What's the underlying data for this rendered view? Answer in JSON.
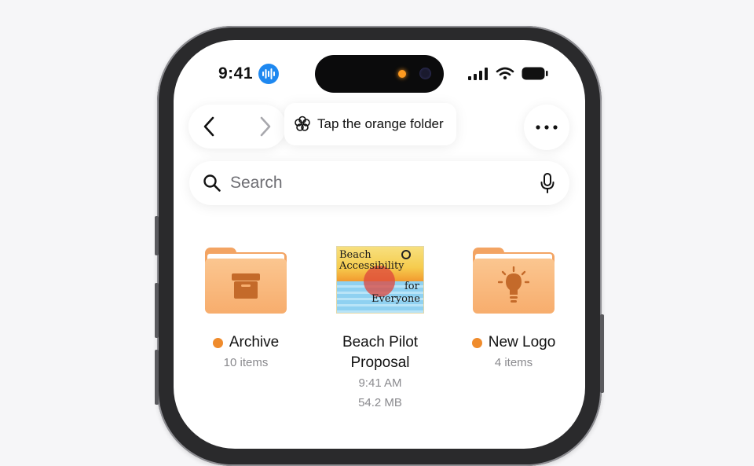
{
  "status_bar": {
    "time": "9:41"
  },
  "navigation": {
    "hint_text": "Tap the orange folder"
  },
  "search": {
    "placeholder": "Search"
  },
  "items": [
    {
      "name": "Archive",
      "subtitle": "10 items",
      "tag_color": "#ef8b2c",
      "icon": "archive-box-icon"
    },
    {
      "name": "Beach Pilot Proposal",
      "subtitle": "9:41 AM",
      "size": "54.2 MB",
      "thumbnail_text": {
        "line1": "Beach",
        "line2": "Accessibility",
        "line3": "for",
        "line4": "Everyone"
      }
    },
    {
      "name": "New Logo",
      "subtitle": "4 items",
      "tag_color": "#ef8b2c",
      "icon": "lightbulb-icon"
    }
  ],
  "colors": {
    "accent": "#1e88f0",
    "folder": "#f3a463",
    "tag_orange": "#ef8b2c"
  }
}
